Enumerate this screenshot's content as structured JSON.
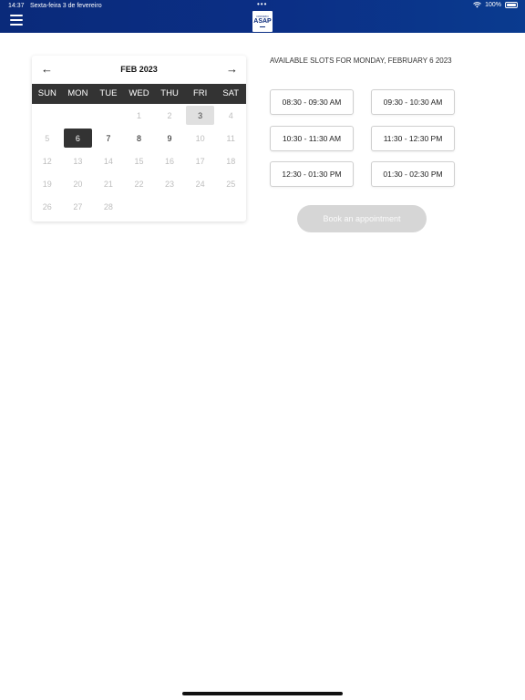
{
  "status_bar": {
    "time": "14:37",
    "date": "Sexta-feira 3 de fevereiro",
    "battery": "100%",
    "dots": "•••"
  },
  "header": {
    "logo_top": "ONTARIO",
    "logo_main": "ASAP"
  },
  "calendar": {
    "prev_icon": "←",
    "next_icon": "→",
    "month_label": "FEB 2023",
    "weekdays": [
      "SUN",
      "MON",
      "TUE",
      "WED",
      "THU",
      "FRI",
      "SAT"
    ],
    "days": [
      {
        "label": "",
        "state": "empty"
      },
      {
        "label": "",
        "state": "empty"
      },
      {
        "label": "",
        "state": "empty"
      },
      {
        "label": "1",
        "state": "disabled"
      },
      {
        "label": "2",
        "state": "disabled"
      },
      {
        "label": "3",
        "state": "today"
      },
      {
        "label": "4",
        "state": "disabled"
      },
      {
        "label": "5",
        "state": "disabled"
      },
      {
        "label": "6",
        "state": "selected"
      },
      {
        "label": "7",
        "state": "active"
      },
      {
        "label": "8",
        "state": "active"
      },
      {
        "label": "9",
        "state": "active"
      },
      {
        "label": "10",
        "state": "disabled"
      },
      {
        "label": "11",
        "state": "disabled"
      },
      {
        "label": "12",
        "state": "disabled"
      },
      {
        "label": "13",
        "state": "disabled"
      },
      {
        "label": "14",
        "state": "disabled"
      },
      {
        "label": "15",
        "state": "disabled"
      },
      {
        "label": "16",
        "state": "disabled"
      },
      {
        "label": "17",
        "state": "disabled"
      },
      {
        "label": "18",
        "state": "disabled"
      },
      {
        "label": "19",
        "state": "disabled"
      },
      {
        "label": "20",
        "state": "disabled"
      },
      {
        "label": "21",
        "state": "disabled"
      },
      {
        "label": "22",
        "state": "disabled"
      },
      {
        "label": "23",
        "state": "disabled"
      },
      {
        "label": "24",
        "state": "disabled"
      },
      {
        "label": "25",
        "state": "disabled"
      },
      {
        "label": "26",
        "state": "disabled"
      },
      {
        "label": "27",
        "state": "disabled"
      },
      {
        "label": "28",
        "state": "disabled"
      }
    ]
  },
  "slots": {
    "title": "AVAILABLE SLOTS FOR MONDAY, FEBRUARY 6 2023",
    "items": [
      "08:30 - 09:30 AM",
      "09:30 - 10:30 AM",
      "10:30 - 11:30 AM",
      "11:30 - 12:30 PM",
      "12:30 - 01:30 PM",
      "01:30 - 02:30 PM"
    ]
  },
  "book_button": "Book an appointment",
  "colors": {
    "header_blue": "#0a2a7a",
    "weekday_bar": "#333333",
    "selected_day": "#333333",
    "disabled_button": "#d6d6d6"
  }
}
